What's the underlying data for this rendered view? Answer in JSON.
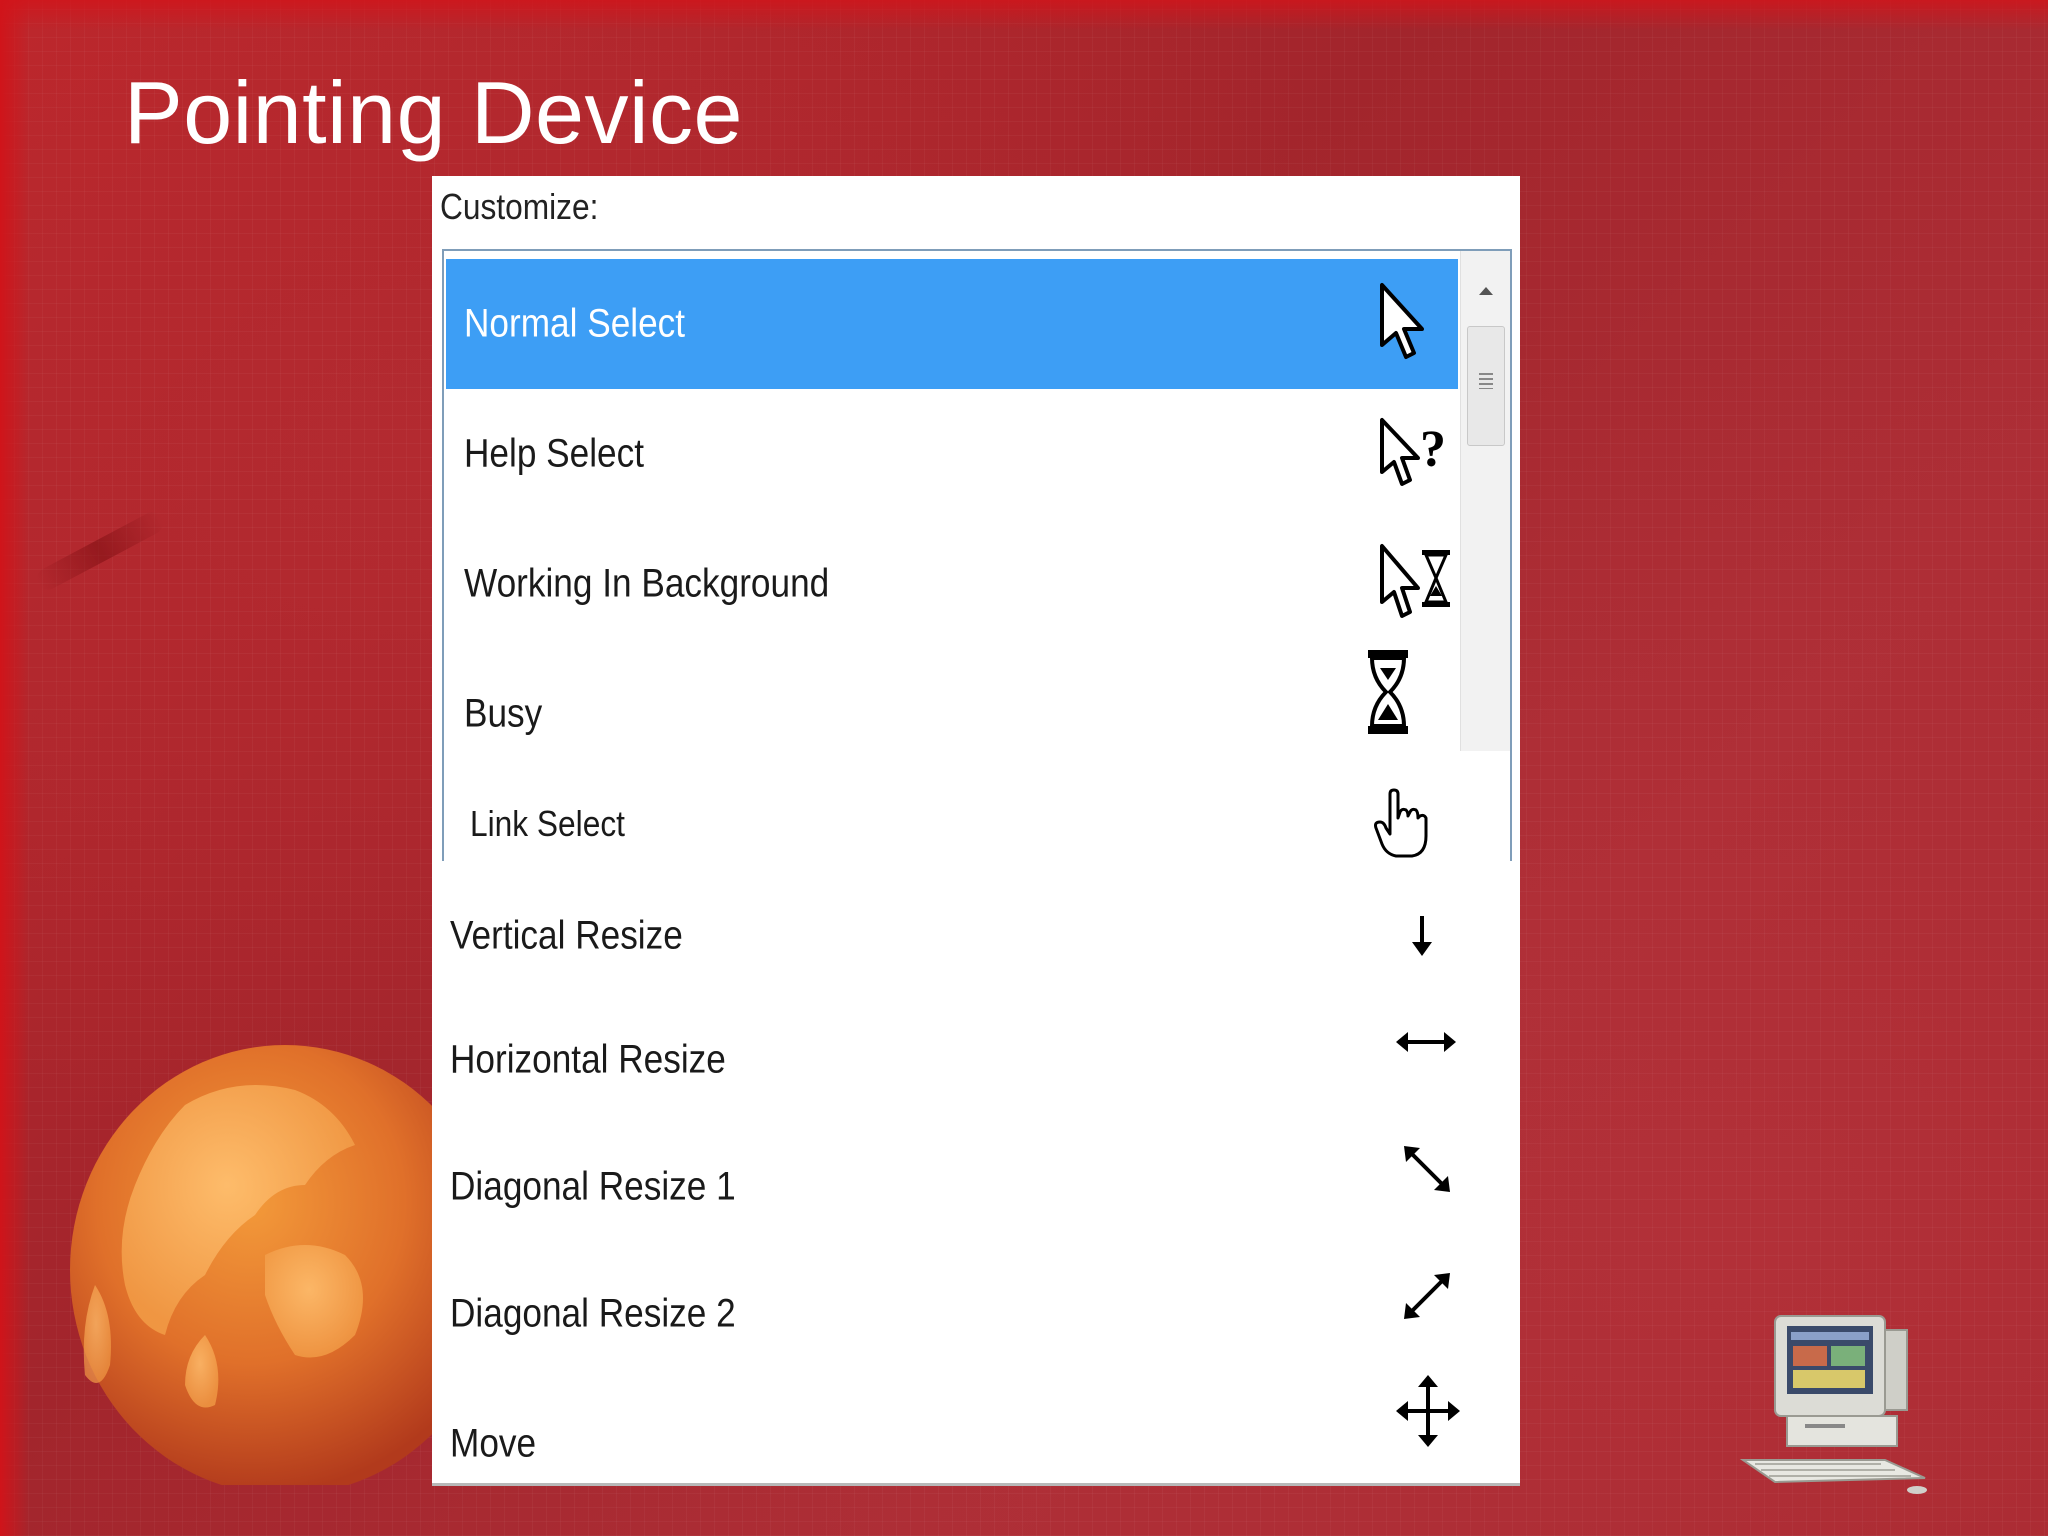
{
  "slide": {
    "title": "Pointing Device"
  },
  "panel": {
    "customize_label": "Customize:",
    "items": [
      {
        "label": "Normal Select",
        "icon": "arrow-cursor-icon",
        "selected": true
      },
      {
        "label": "Help Select",
        "icon": "help-cursor-icon",
        "selected": false
      },
      {
        "label": "Working In Background",
        "icon": "busy-arrow-cursor-icon",
        "selected": false
      },
      {
        "label": "Busy",
        "icon": "hourglass-icon",
        "selected": false
      },
      {
        "label": "Link Select",
        "icon": "hand-cursor-icon",
        "selected": false
      },
      {
        "label": "Vertical Resize",
        "icon": "vertical-resize-icon",
        "selected": false
      },
      {
        "label": "Horizontal Resize",
        "icon": "horizontal-resize-icon",
        "selected": false
      },
      {
        "label": "Diagonal Resize 1",
        "icon": "diagonal-resize-1-icon",
        "selected": false
      },
      {
        "label": "Diagonal Resize 2",
        "icon": "diagonal-resize-2-icon",
        "selected": false
      },
      {
        "label": "Move",
        "icon": "move-icon",
        "selected": false
      }
    ]
  },
  "colors": {
    "background": "#a8262d",
    "selection": "#3d9ef5",
    "title_text": "#ffffff"
  }
}
